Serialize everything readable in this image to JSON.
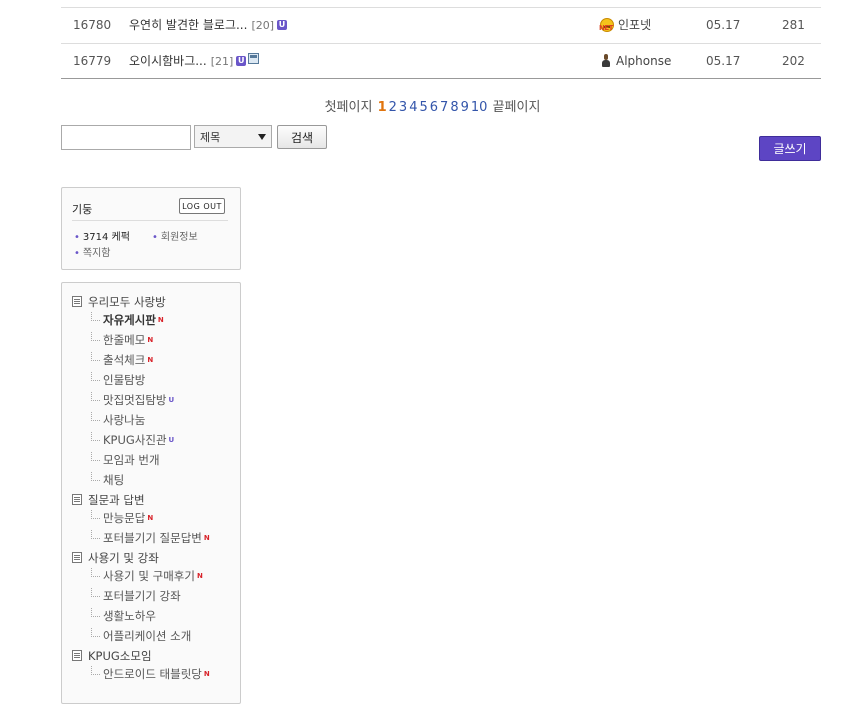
{
  "board": {
    "rows": [
      {
        "num": "16780",
        "title": "우연히 발견한 블로그...",
        "comments": "[20]",
        "badge": "U",
        "writer": "인포넷",
        "writer_tag": "NET",
        "date": "05.17",
        "hits": "281"
      },
      {
        "num": "16779",
        "title": "오이시함바그...",
        "comments": "[21]",
        "badge": "U",
        "writer": "Alphonse",
        "date": "05.17",
        "hits": "202"
      }
    ]
  },
  "pager": {
    "first": "첫페이지",
    "current": "1",
    "pages": [
      "2",
      "3",
      "4",
      "5",
      "6",
      "7",
      "8",
      "9",
      "10"
    ],
    "last": "끝페이지"
  },
  "search": {
    "input_value": "",
    "select_value": "제목",
    "button_label": "검색"
  },
  "write_button": "글쓰기",
  "login": {
    "username": "기둥",
    "logout_label": "LOG OUT",
    "points": "3714 케퍽",
    "member_info": "회원정보",
    "messages": "쪽지함"
  },
  "menu": {
    "cat1": {
      "label": "우리모두 사랑방",
      "items": [
        "자유게시판",
        "한줄메모",
        "출석체크",
        "인물탐방",
        "맛집멋집탐방",
        "사랑나눔",
        "KPUG사진관",
        "모임과 번개",
        "채팅"
      ]
    },
    "cat2": {
      "label": "질문과 답변",
      "items": [
        "만능문답",
        "포터블기기 질문답변"
      ]
    },
    "cat3": {
      "label": "사용기 및 강좌",
      "items": [
        "사용기 및 구매후기",
        "포터블기기 강좌",
        "생활노하우",
        "어플리케이션 소개"
      ]
    },
    "cat4": {
      "label": "KPUG소모임",
      "items": [
        "안드로이드 태블릿당"
      ]
    },
    "new_mark": "N",
    "upd_mark": "U"
  },
  "colors": {
    "accent": "#5d45c4",
    "current_page": "#e0740e",
    "link": "#3355aa",
    "new": "#d8232a"
  }
}
